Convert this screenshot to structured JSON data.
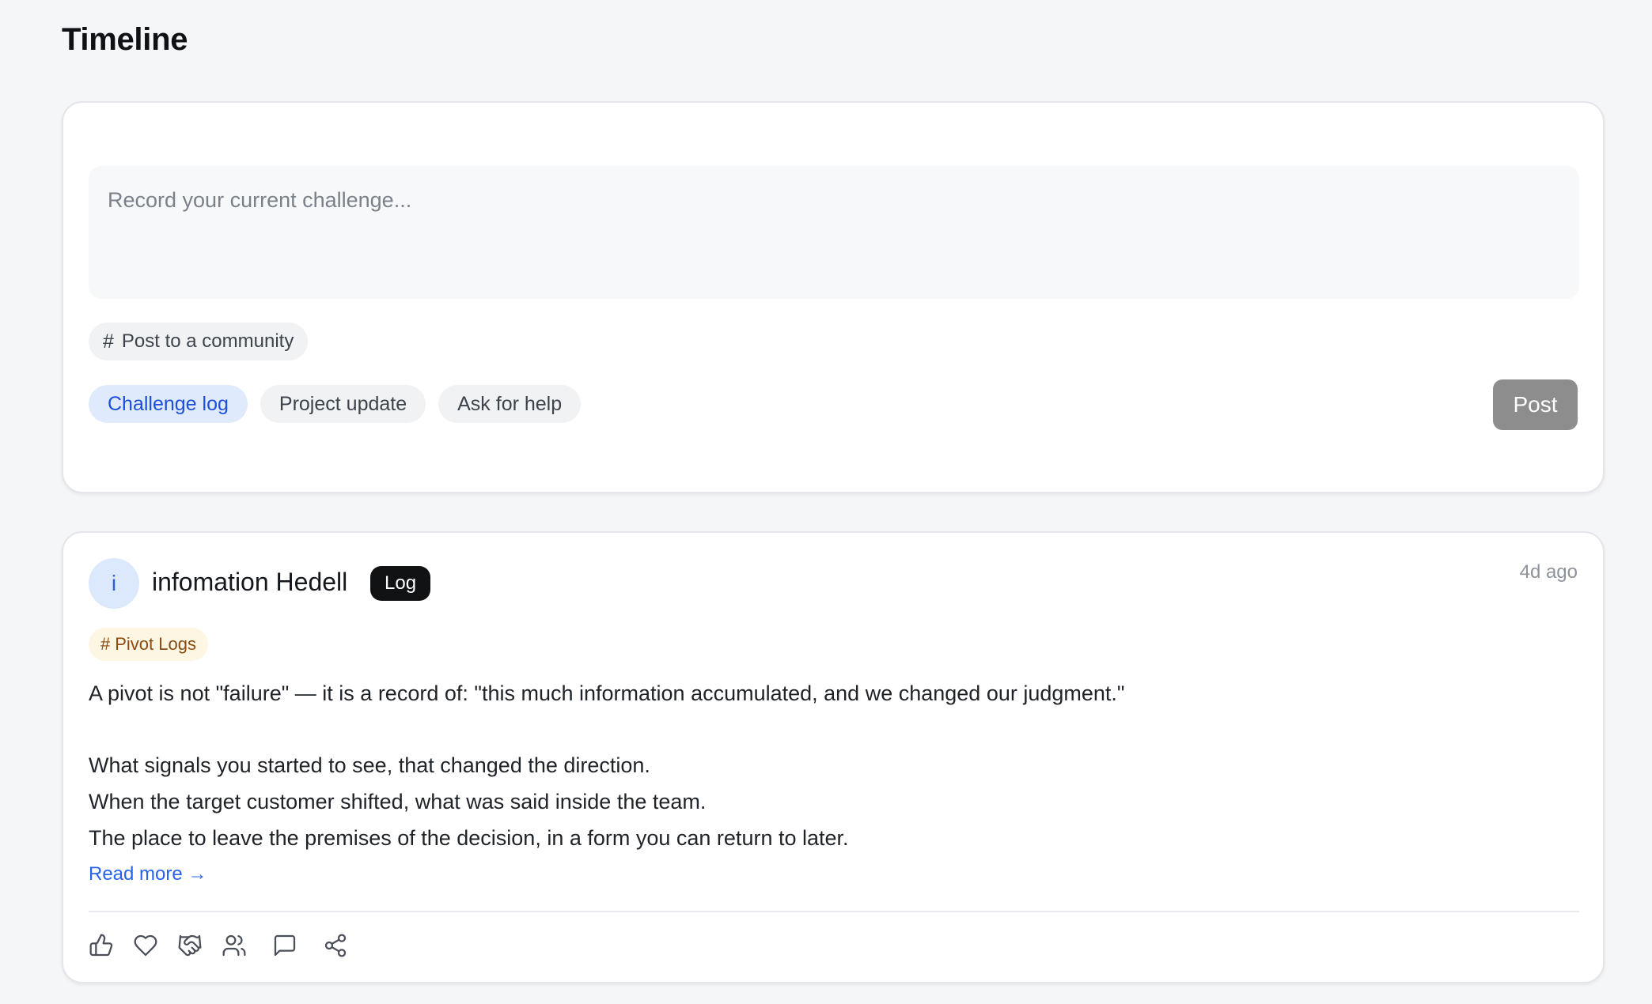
{
  "page": {
    "title": "Timeline"
  },
  "composer": {
    "placeholder": "Record your current challenge...",
    "community_chip": {
      "icon": "hash-icon",
      "label": "Post to a community"
    },
    "post_types": [
      {
        "label": "Challenge log",
        "selected": true
      },
      {
        "label": "Project update",
        "selected": false
      },
      {
        "label": "Ask for help",
        "selected": false
      }
    ],
    "post_button": "Post"
  },
  "post": {
    "avatar_initial": "i",
    "author": "infomation Hedell",
    "badge": "Log",
    "timestamp": "4d ago",
    "tag": "Pivot Logs",
    "body": [
      "A pivot is not \"failure\" — it is a record of: \"this much information accumulated, and we changed our judgment.\"",
      "What signals you started to see, that changed the direction.",
      "When the target customer shifted, what was said inside the team.",
      "The place to leave the premises of the decision, in a form you can return to later."
    ],
    "read_more": "Read more →",
    "actions": [
      "thumbs-up-icon",
      "heart-icon",
      "handshake-icon",
      "users-icon",
      "comment-icon",
      "share-icon"
    ]
  },
  "colors": {
    "accent": "#1d4fd8",
    "accent_bg": "#dfeafd",
    "post_button_bg": "#8d8d8d",
    "badge_bg": "#111214",
    "tag_bg": "#fdf6e3",
    "tag_text": "#8a4b12",
    "link": "#2563eb"
  }
}
